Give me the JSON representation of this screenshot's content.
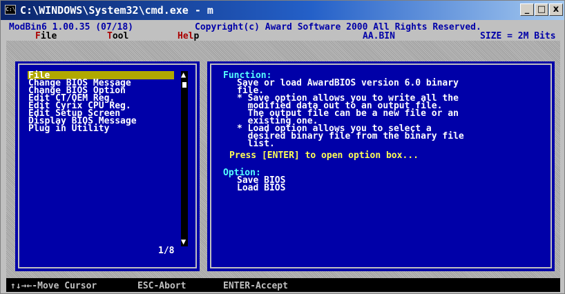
{
  "window": {
    "title": "C:\\WINDOWS\\System32\\cmd.exe - m",
    "icon_text": "C:\\",
    "buttons": {
      "minimize": "_",
      "maximize": "□",
      "close": "x"
    }
  },
  "header": {
    "app": "ModBin6 1.00.35 (07/18)",
    "copyright": "Copyright(c) Award Software 2000 All Rights Reserved."
  },
  "menu": {
    "file": {
      "hot": "F",
      "rest": "ile"
    },
    "tool": {
      "hot": "T",
      "rest": "ool"
    },
    "help": {
      "hot": "Hel",
      "rest": "p"
    },
    "filename": "AA.BIN",
    "size": "SIZE = 2M Bits"
  },
  "list": {
    "items": [
      "File",
      "Change BIOS Message",
      "Change BIOS Option",
      "Edit CT/OEM Reg.",
      "Edit Cyrix CPU Reg.",
      "Edit Setup Screen",
      "Display BIOS Message",
      "Plug in Utility"
    ],
    "selected_index": 0,
    "position": "1/8"
  },
  "info": {
    "function_label": "Function:",
    "function_lines": [
      "Save or load AwardBIOS version 6.0 binary",
      "file."
    ],
    "bullets": [
      [
        "* Save option allows you to write all the",
        "  modified data out to an output file.",
        "  The output file can be a new file or an",
        "  existing one."
      ],
      [
        "* Load option allows you to select a",
        "  desired binary file from the binary file",
        "  list."
      ]
    ],
    "prompt": "Press [ENTER] to open option box...",
    "option_label": "Option:",
    "options": [
      "Save BIOS",
      "Load BIOS"
    ]
  },
  "footer": {
    "move": "↑↓→←-Move Cursor",
    "esc": "ESC-Abort",
    "enter": "ENTER-Accept"
  },
  "colors": {
    "panel": "#0000a8",
    "highlight": "#b0a800",
    "title_bar": "#0a246a",
    "accent_cyan": "#55ffff",
    "accent_yellow": "#ffff55"
  }
}
